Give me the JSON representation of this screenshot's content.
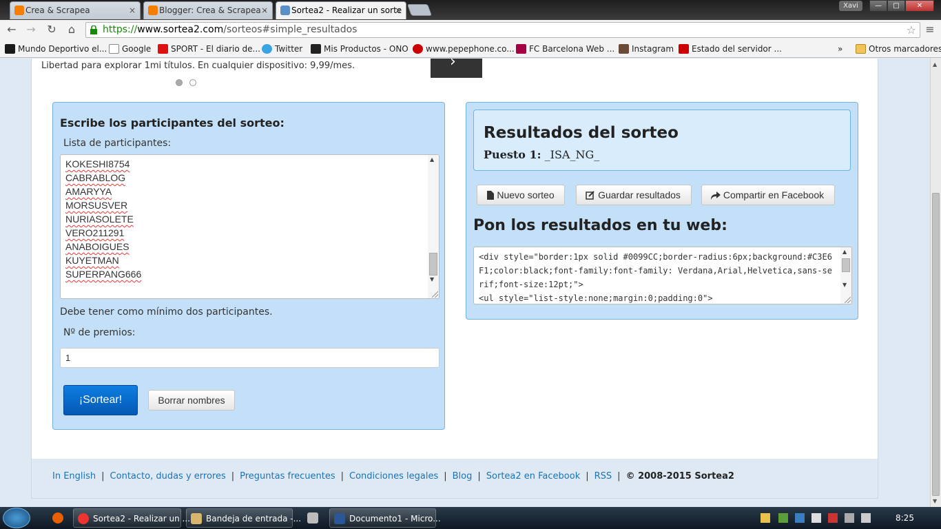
{
  "browser": {
    "tabs": [
      {
        "label": "Crea & Scrapea",
        "close": "×"
      },
      {
        "label": "Blogger: Crea & Scrapea -",
        "close": "×"
      },
      {
        "label": "Sortea2 - Realizar un sorte",
        "close": "×"
      }
    ],
    "user": "Xavi",
    "window_controls": {
      "minimize": "—",
      "maximize": "□",
      "close": "✕"
    },
    "nav": {
      "back": "←",
      "forward": "→",
      "reload": "↻",
      "home": "⌂",
      "menu": "≡"
    },
    "url": {
      "protocol": "https://",
      "host": "www.sortea2.com",
      "path": "/sorteos#simple_resultados"
    },
    "star": "☆",
    "bookmarks": [
      {
        "label": "Mundo Deportivo el...",
        "icon": "md-icon",
        "color": "#1a1a1a"
      },
      {
        "label": "Google",
        "icon": "page-icon",
        "color": "#ffffff"
      },
      {
        "label": "SPORT - El diario de...",
        "icon": "sport-icon",
        "color": "#d11"
      },
      {
        "label": "Twitter",
        "icon": "twitter-icon",
        "color": "#3aa3e3"
      },
      {
        "label": "Mis Productos - ONO",
        "icon": "ono-icon",
        "color": "#222"
      },
      {
        "label": "www.pepephone.co...",
        "icon": "pepephone-icon",
        "color": "#c00"
      },
      {
        "label": "FC Barcelona Web ...",
        "icon": "fcb-icon",
        "color": "#a50044"
      },
      {
        "label": "Instagram",
        "icon": "instagram-icon",
        "color": "#6b4a36"
      },
      {
        "label": "Estado del servidor ...",
        "icon": "server-icon",
        "color": "#c00"
      }
    ],
    "bookmarks_more": "»",
    "other_bookmarks": "Otros marcadores"
  },
  "ad": {
    "text": "Libertad para explorar 1mi títulos. En cualquier dispositivo: 9,99/mes.",
    "arrow": "›"
  },
  "form": {
    "heading": "Escribe los participantes del sorteo:",
    "list_label": "Lista de participantes:",
    "participants": [
      "KOKESHI8754",
      "CABRABLOG",
      "AMARYYA",
      "MORSUSVER",
      "NURIASOLETE",
      "VERO211291",
      "ANABOIGUES",
      "KUYETMAN",
      "SUPERPANG666"
    ],
    "hint": "Debe tener como mínimo dos participantes.",
    "prizes_label": "Nº de premios:",
    "prizes_value": "1",
    "draw_button": "¡Sortear!",
    "clear_button": "Borrar nombres"
  },
  "results": {
    "title": "Resultados del sorteo",
    "position_label": "Puesto 1:",
    "position_value": "_ISA_NG_",
    "new_draw": "Nuevo sorteo",
    "save": "Guardar resultados",
    "share": "Compartir en Facebook",
    "web_heading": "Pon los resultados en tu web:",
    "code": "<div style=\"border:1px solid #0099CC;border-radius:6px;background:#C3E6F1;color:black;font-family:font-family: Verdana,Arial,Helvetica,sans-serif;font-size:12pt;\">\n<ul style=\"list-style:none;margin:0;padding:0\">"
  },
  "footer": {
    "links": [
      "In English",
      "Contacto, dudas y errores",
      "Preguntas frecuentes",
      "Condiciones legales",
      "Blog",
      "Sortea2 en Facebook",
      "RSS"
    ],
    "separator": "|",
    "copyright": "© 2008-2015 Sortea2"
  },
  "taskbar": {
    "items": [
      "Sortea2 - Realizar un ...",
      "Bandeja de entrada -...",
      "Documento1 - Micro..."
    ],
    "clock": "8:25"
  },
  "colors": {
    "panel_bg": "#c3e0f8",
    "panel_border": "#6fb3e0",
    "primary": "#0a6ad0",
    "link": "#1a73b6"
  }
}
